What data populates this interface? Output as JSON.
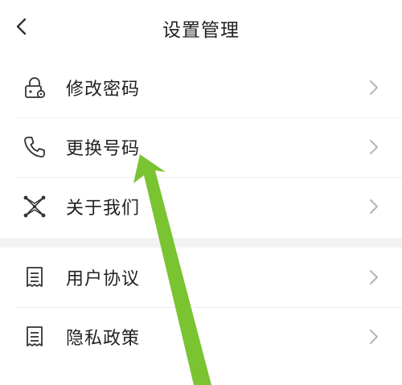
{
  "header": {
    "title": "设置管理",
    "back_icon": "chevron-left-icon"
  },
  "menu": {
    "groups": [
      {
        "items": [
          {
            "label": "修改密码",
            "icon": "lock-gear-icon"
          },
          {
            "label": "更换号码",
            "icon": "phone-icon"
          },
          {
            "label": "关于我们",
            "icon": "network-icon"
          }
        ]
      },
      {
        "items": [
          {
            "label": "用户协议",
            "icon": "document-icon"
          },
          {
            "label": "隐私政策",
            "icon": "document-icon"
          }
        ]
      }
    ],
    "chevron_icon": "chevron-right-icon"
  },
  "colors": {
    "arrow": "#7ac331",
    "text": "#222222",
    "icon": "#333333",
    "chevron": "#b5b5b5",
    "divider": "#ededed",
    "gap": "#f2f2f2"
  }
}
